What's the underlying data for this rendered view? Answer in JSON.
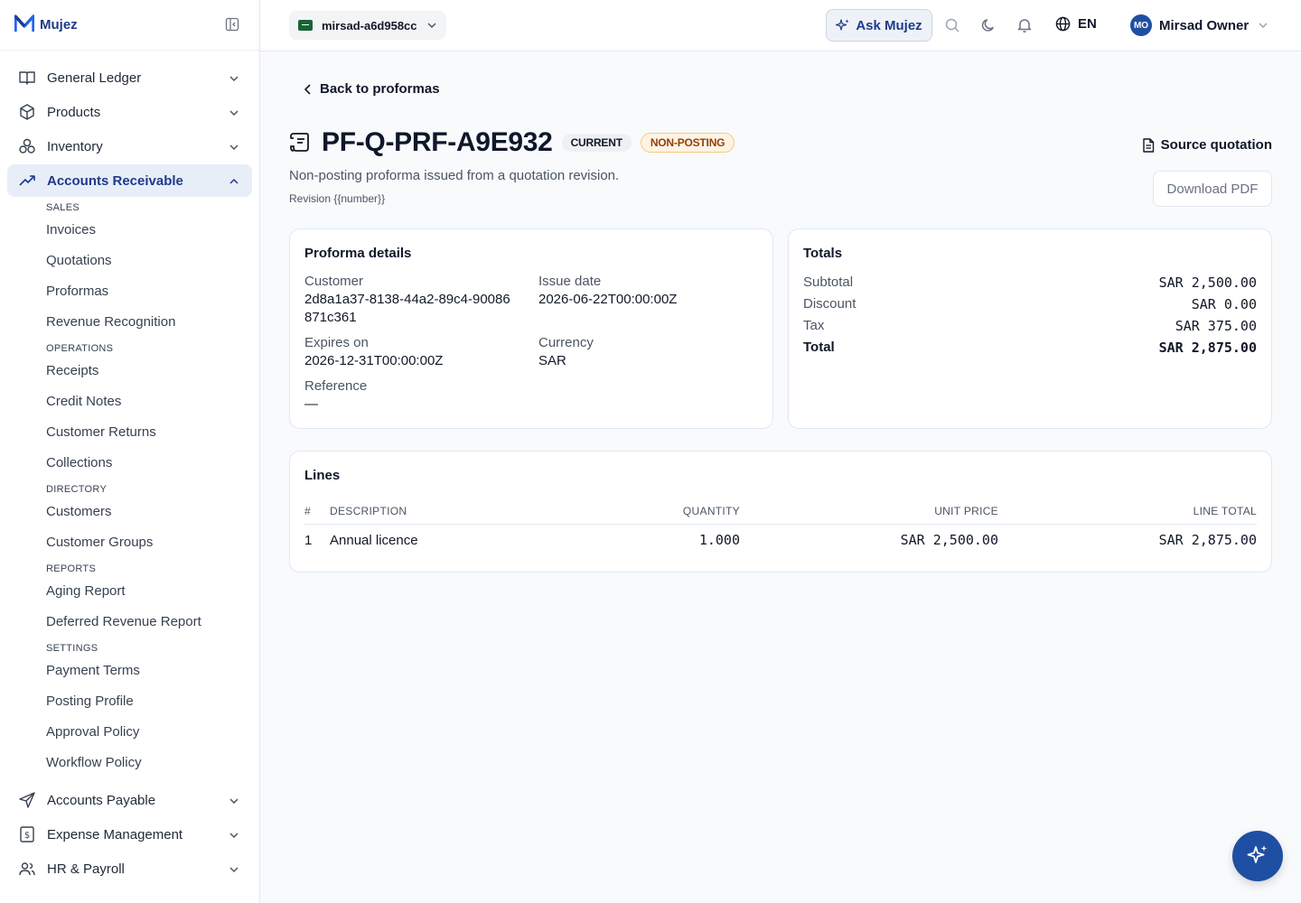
{
  "app": {
    "name": "Mujez"
  },
  "sidebar": {
    "items": [
      {
        "label": "General Ledger"
      },
      {
        "label": "Products"
      },
      {
        "label": "Inventory"
      },
      {
        "label": "Accounts Receivable"
      },
      {
        "label": "Accounts Payable"
      },
      {
        "label": "Expense Management"
      },
      {
        "label": "HR & Payroll"
      }
    ],
    "ar_sections": [
      {
        "title": "SALES",
        "items": [
          "Invoices",
          "Quotations",
          "Proformas",
          "Revenue Recognition"
        ]
      },
      {
        "title": "OPERATIONS",
        "items": [
          "Receipts",
          "Credit Notes",
          "Customer Returns",
          "Collections"
        ]
      },
      {
        "title": "DIRECTORY",
        "items": [
          "Customers",
          "Customer Groups"
        ]
      },
      {
        "title": "REPORTS",
        "items": [
          "Aging Report",
          "Deferred Revenue Report"
        ]
      },
      {
        "title": "SETTINGS",
        "items": [
          "Payment Terms",
          "Posting Profile",
          "Approval Policy",
          "Workflow Policy"
        ]
      }
    ]
  },
  "topbar": {
    "tenant": "mirsad-a6d958cc",
    "ask_label": "Ask Mujez",
    "language": "EN",
    "user_initials": "MO",
    "user_name": "Mirsad Owner"
  },
  "page": {
    "back_label": "Back to proformas",
    "title": "PF-Q-PRF-A9E932",
    "badge_current": "CURRENT",
    "badge_nonposting": "NON-POSTING",
    "subtitle": "Non-posting proforma issued from a quotation revision.",
    "revision": "Revision {{number}}",
    "source_quotation_label": "Source quotation",
    "download_label": "Download PDF"
  },
  "details": {
    "heading": "Proforma details",
    "customer_label": "Customer",
    "customer_value": "2d8a1a37-8138-44a2-89c4-90086871c361",
    "issue_label": "Issue date",
    "issue_value": "2026-06-22T00:00:00Z",
    "expires_label": "Expires on",
    "expires_value": "2026-12-31T00:00:00Z",
    "currency_label": "Currency",
    "currency_value": "SAR",
    "reference_label": "Reference",
    "reference_value": "—"
  },
  "totals": {
    "heading": "Totals",
    "rows": [
      {
        "label": "Subtotal",
        "value": "SAR 2,500.00"
      },
      {
        "label": "Discount",
        "value": "SAR 0.00"
      },
      {
        "label": "Tax",
        "value": "SAR 375.00"
      },
      {
        "label": "Total",
        "value": "SAR 2,875.00"
      }
    ]
  },
  "lines": {
    "heading": "Lines",
    "columns": [
      "#",
      "DESCRIPTION",
      "QUANTITY",
      "UNIT PRICE",
      "LINE TOTAL"
    ],
    "rows": [
      {
        "num": "1",
        "description": "Annual licence",
        "quantity": "1.000",
        "unit_price": "SAR 2,500.00",
        "line_total": "SAR 2,875.00"
      }
    ]
  }
}
